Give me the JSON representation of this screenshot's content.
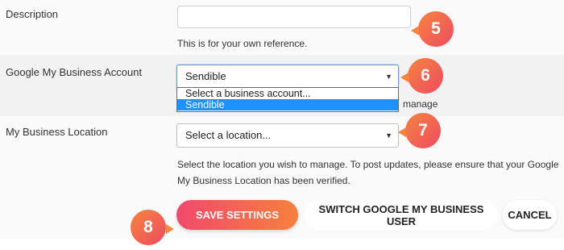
{
  "description": {
    "label": "Description",
    "value": "",
    "help": "This is for your own reference.",
    "step": "5"
  },
  "account": {
    "label": "Google My Business Account",
    "selected": "Sendible",
    "options": [
      "Select a business account...",
      "Sendible"
    ],
    "partial_help": "manage",
    "step": "6"
  },
  "location": {
    "label": "My Business Location",
    "selected": "Select a location...",
    "help_line1": "Select the location you wish to manage. To post updates, please ensure that your Google",
    "help_line2": "My Business Location has been verified.",
    "step": "7"
  },
  "actions": {
    "save": "SAVE SETTINGS",
    "switch_user": "SWITCH GOOGLE MY BUSINESS USER",
    "cancel": "CANCEL",
    "step": "8"
  },
  "icons": {
    "dropdown_caret": "caret-down-icon"
  },
  "colors": {
    "badge_start": "#f6843f",
    "badge_end": "#ee4b62",
    "selection": "#1e90ff"
  }
}
